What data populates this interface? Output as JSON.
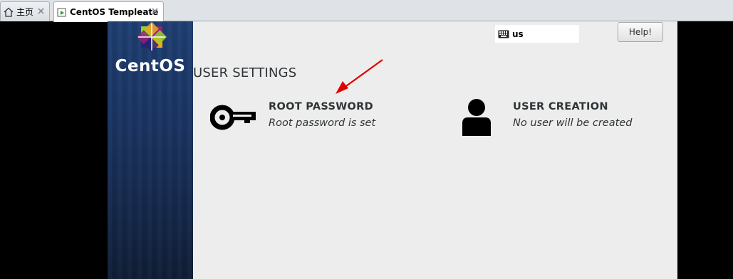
{
  "tabs": [
    {
      "label": "主页",
      "icon": "home-icon"
    },
    {
      "label": "CentOS Templeate",
      "icon": "vm-icon"
    }
  ],
  "installer": {
    "brand": "CentOS",
    "keyboard": {
      "layout": "us",
      "icon": "keyboard-icon"
    },
    "help_label": "Help!",
    "section_title": "USER SETTINGS",
    "spokes": [
      {
        "title": "ROOT PASSWORD",
        "status": "Root password is set",
        "icon": "key-icon"
      },
      {
        "title": "USER CREATION",
        "status": "No user will be created",
        "icon": "user-icon"
      }
    ]
  },
  "colors": {
    "sidebar": "#1a3462",
    "main_bg": "#ededed",
    "annotation_arrow": "#e00000"
  }
}
